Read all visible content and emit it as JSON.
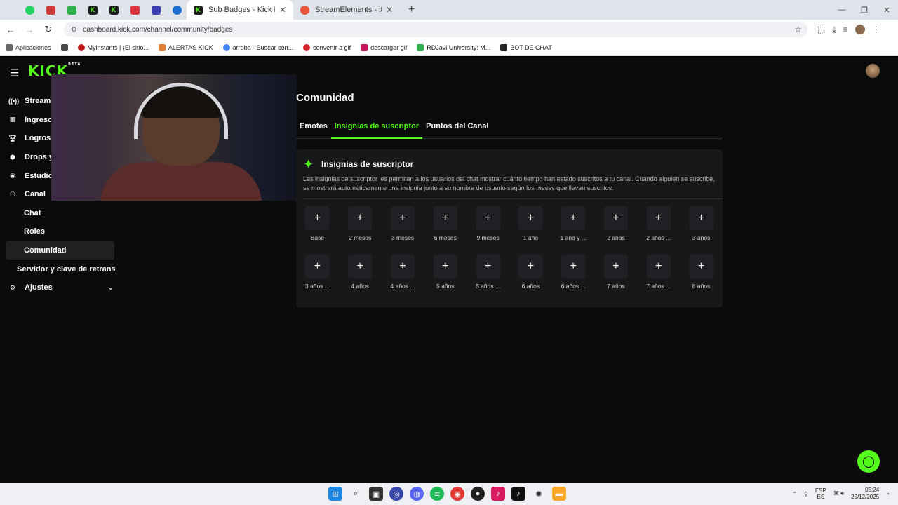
{
  "browser": {
    "tabs": [
      {
        "title": "Sub Badges - Kick Dashboard",
        "active": true
      },
      {
        "title": "StreamElements - its_yero",
        "active": false
      }
    ],
    "url": "dashboard.kick.com/channel/community/badges",
    "bookmarks": [
      "Aplicaciones",
      "Myinstants | ¡El sitio...",
      "ALERTAS KICK",
      "arroba - Buscar con...",
      "convertir a gif",
      "descargar gif",
      "RDJavi University: M...",
      "BOT DE CHAT"
    ]
  },
  "header": {
    "logo": "KICK",
    "logo_badge": "BETA"
  },
  "sidebar": {
    "items": [
      {
        "label": "Stream",
        "icon": "broadcast-icon"
      },
      {
        "label": "Ingreso",
        "icon": "revenue-icon"
      },
      {
        "label": "Logros",
        "icon": "trophy-icon"
      },
      {
        "label": "Drops y",
        "icon": "drops-icon"
      },
      {
        "label": "Estudio",
        "icon": "studio-icon"
      },
      {
        "label": "Canal",
        "icon": "channel-icon"
      }
    ],
    "sub_items": [
      "Chat",
      "Roles",
      "Comunidad"
    ],
    "server_item": "Servidor y clave de retrans",
    "settings": "Ajustes"
  },
  "main": {
    "title": "Comunidad",
    "tabs": [
      "Emotes",
      "Insignias de suscriptor",
      "Puntos del Canal"
    ],
    "panel": {
      "title": "Insignias de suscriptor",
      "description": "Las insignias de suscriptor les permiten a los usuarios del chat mostrar cuánto tiempo han estado suscritos a tu canal. Cuando alguien se suscribe, se mostrará automáticamente una insignia junto a su nombre de usuario según los meses que llevan suscritos.",
      "badges": [
        "Base",
        "2 meses",
        "3 meses",
        "6 meses",
        "9 meses",
        "1 año",
        "1 año y ...",
        "2 años",
        "2 años ...",
        "3 años",
        "3 años ...",
        "4 años",
        "4 años ...",
        "5 años",
        "5 años ...",
        "6 años",
        "6 años ...",
        "7 años",
        "7 años ...",
        "8 años"
      ],
      "add_symbol": "+"
    }
  },
  "taskbar": {
    "lang_top": "ESP",
    "lang_bottom": "ES",
    "time": "05:24",
    "date": "29/12/2025"
  },
  "colors": {
    "accent": "#53fc18",
    "background": "#0b0b0c",
    "panel": "#17181a"
  }
}
